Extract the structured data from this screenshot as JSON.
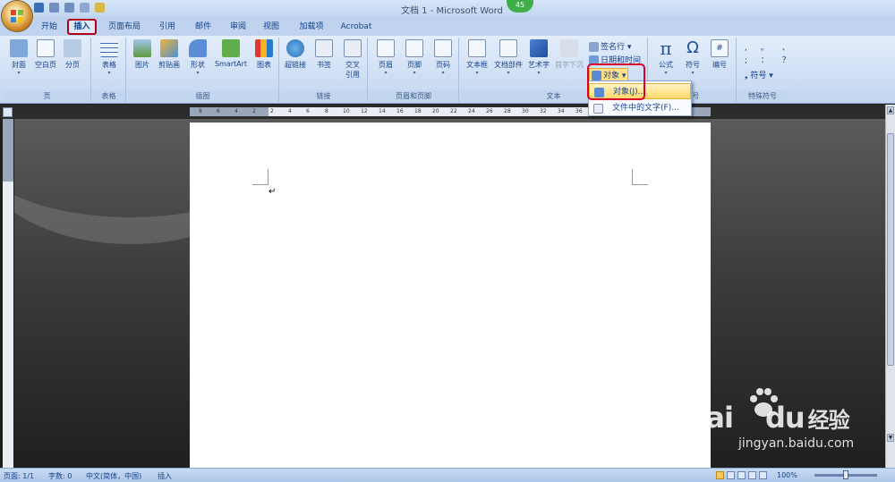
{
  "window": {
    "title": "文档 1 - Microsoft Word",
    "notification_count": "45"
  },
  "tabs": [
    {
      "label": "开始",
      "active": false
    },
    {
      "label": "插入",
      "active": true
    },
    {
      "label": "页面布局",
      "active": false
    },
    {
      "label": "引用",
      "active": false
    },
    {
      "label": "邮件",
      "active": false
    },
    {
      "label": "审阅",
      "active": false
    },
    {
      "label": "视图",
      "active": false
    },
    {
      "label": "加载项",
      "active": false
    },
    {
      "label": "Acrobat",
      "active": false
    }
  ],
  "ribbon": {
    "pages": {
      "label": "页",
      "buttons": [
        "封面",
        "空白页",
        "分页"
      ]
    },
    "tables": {
      "label": "表格",
      "buttons": [
        "表格"
      ]
    },
    "illustrations": {
      "label": "插图",
      "buttons": [
        "图片",
        "剪贴画",
        "形状",
        "SmartArt",
        "图表"
      ]
    },
    "links": {
      "label": "链接",
      "buttons": [
        "超链接",
        "书签",
        "交叉",
        "引用"
      ]
    },
    "header_footer": {
      "label": "页眉和页脚",
      "buttons": [
        "页眉",
        "页脚",
        "页码"
      ]
    },
    "text": {
      "label": "文本",
      "buttons": [
        "文本框",
        "文档部件",
        "艺术字",
        "首字下沉"
      ],
      "small_items": [
        "签名行",
        "日期和时间",
        "对象"
      ]
    },
    "symbols": {
      "label": "符号",
      "buttons": [
        "公式",
        "符号",
        "编号"
      ]
    },
    "special": {
      "label": "特殊符号",
      "small": "符号"
    }
  },
  "dropdown": {
    "items": [
      "对象(J)...",
      "文件中的文字(F)..."
    ]
  },
  "ruler": {
    "numbers": [
      "8",
      "6",
      "4",
      "2",
      "2",
      "4",
      "6",
      "8",
      "10",
      "12",
      "14",
      "16",
      "18",
      "20",
      "22",
      "24",
      "26",
      "28",
      "30",
      "32",
      "34",
      "36",
      "38",
      "40",
      "42",
      "44",
      "46",
      "48"
    ]
  },
  "status": {
    "page": "页面: 1/1",
    "words": "字数: 0",
    "language": "中文(简体，中国)",
    "mode": "插入",
    "zoom": "100%"
  },
  "watermark": {
    "brand": "Bai",
    "brand2": "du",
    "brand3": "经验",
    "url": "jingyan.baidu.com"
  },
  "colors": {
    "active_tab_border": "#b0001a",
    "highlight_box": "#d8002a",
    "ribbon_bg": "#dbe7f6"
  }
}
